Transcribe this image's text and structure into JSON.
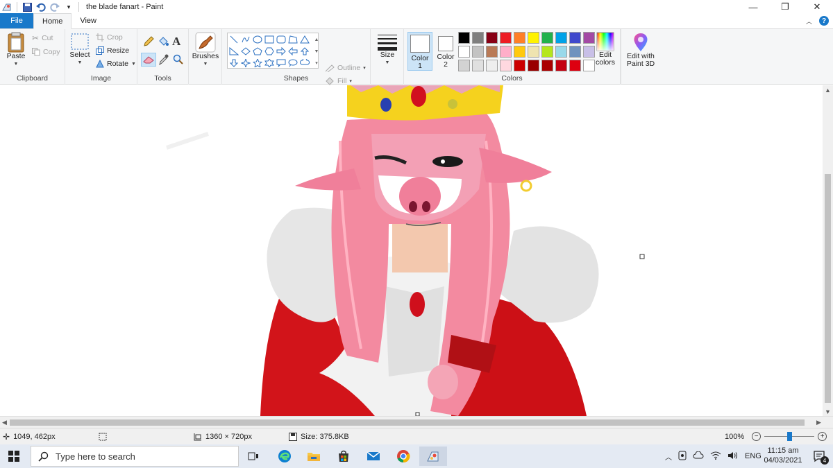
{
  "window": {
    "title": "the blade fanart - Paint",
    "controls": [
      "—",
      "❐",
      "✕"
    ]
  },
  "tabs": [
    {
      "label": "File"
    },
    {
      "label": "Home"
    },
    {
      "label": "View"
    }
  ],
  "ribbon": {
    "clipboard": {
      "label": "Clipboard",
      "paste": "Paste",
      "cut": "Cut",
      "copy": "Copy"
    },
    "image": {
      "label": "Image",
      "select": "Select",
      "crop": "Crop",
      "resize": "Resize",
      "rotate": "Rotate"
    },
    "tools": {
      "label": "Tools"
    },
    "brushes": {
      "label": "Brushes"
    },
    "shapes": {
      "label": "Shapes",
      "outline": "Outline",
      "fill": "Fill"
    },
    "size": {
      "label": "Size"
    },
    "colors": {
      "label": "Colors",
      "color1": "Color\n1",
      "color2": "Color\n2",
      "edit_colors": "Edit\ncolors",
      "edit_paint3d": "Edit with\nPaint 3D",
      "palette": [
        "#000000",
        "#7f7f7f",
        "#880015",
        "#ed1c24",
        "#ff7f27",
        "#fff200",
        "#22b14c",
        "#00a2e8",
        "#3f48cc",
        "#a349a4",
        "#ffffff",
        "#c3c3c3",
        "#b97a57",
        "#ffaec9",
        "#ffc90e",
        "#efe4b0",
        "#b5e61d",
        "#99d9ea",
        "#7092be",
        "#c8bfe7",
        "#d3d3d3",
        "#e0e0e0",
        "#eeeeee",
        "#ffd8e0",
        "#cc0000",
        "#990000",
        "#aa0000",
        "#c40010",
        "#dd0010",
        "#ffffff"
      ]
    }
  },
  "status": {
    "cursor_pos": "1049, 462px",
    "dimensions": "1360 × 720px",
    "size": "Size: 375.8KB",
    "zoom": "100%"
  },
  "taskbar": {
    "search_placeholder": "Type here to search",
    "lang": "ENG",
    "time": "11:15 am",
    "date": "04/03/2021",
    "notif_count": "4"
  }
}
